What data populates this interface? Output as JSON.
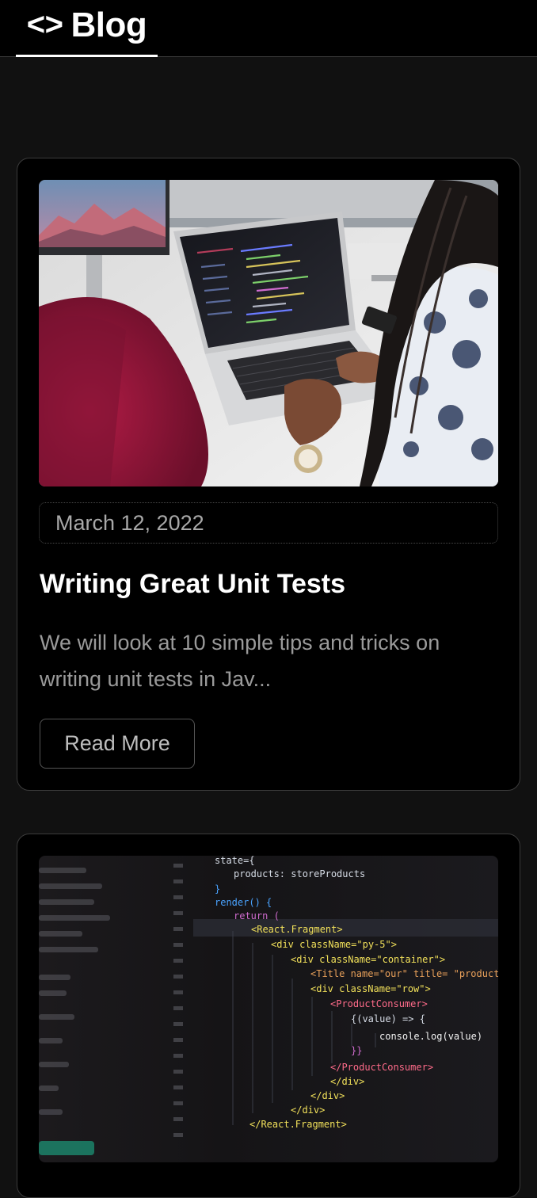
{
  "header": {
    "logo_glyph": "<>",
    "title": "Blog"
  },
  "posts": [
    {
      "image_alt": "photo: developers typing code on a laptop",
      "date": "March 12, 2022",
      "title": "Writing Great Unit Tests",
      "excerpt": "We will look at 10 simple tips and tricks on writing unit tests in Jav...",
      "button_label": "Read More"
    },
    {
      "image_alt": "photo: React JSX code on a dark monitor",
      "code_lines": [
        "state={",
        "products: storeProducts",
        "}",
        "render() {",
        "return (",
        "<React.Fragment>",
        "<div className=\"py-5\">",
        "<div className=\"container\">",
        "<Title name=\"our\" title= \"product",
        "<div className=\"row\">",
        "<ProductConsumer>",
        "{(value) => {",
        "console.log(value)",
        "}}",
        "</ProductConsumer>",
        "</div>",
        "</div>",
        "</div>",
        "</React.Fragment>"
      ]
    }
  ]
}
